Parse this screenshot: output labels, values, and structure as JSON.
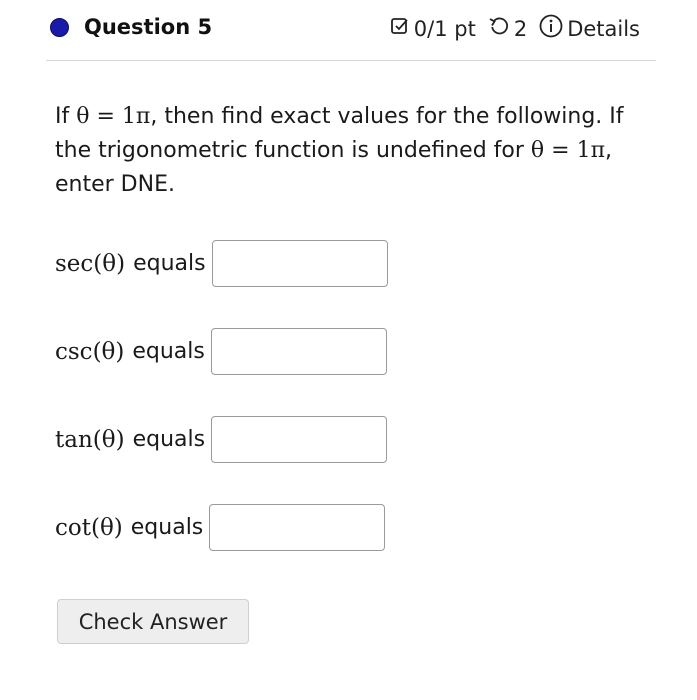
{
  "header": {
    "question_title": "Question 5",
    "score": "0/1 pt",
    "attempts": "2",
    "details_label": "Details",
    "dot_color": "#1a1aa8"
  },
  "prompt": {
    "text_1": "If ",
    "math_1": "θ = 1π",
    "text_2": ", then find exact values for the following. If the trigonometric function is undefined for ",
    "math_2": "θ = 1π",
    "text_3": ", enter DNE."
  },
  "rows": [
    {
      "fn": "sec(θ)",
      "label": "equals",
      "value": ""
    },
    {
      "fn": "csc(θ)",
      "label": "equals",
      "value": ""
    },
    {
      "fn": "tan(θ)",
      "label": "equals",
      "value": ""
    },
    {
      "fn": "cot(θ)",
      "label": "equals",
      "value": ""
    }
  ],
  "check_button_label": "Check Answer"
}
